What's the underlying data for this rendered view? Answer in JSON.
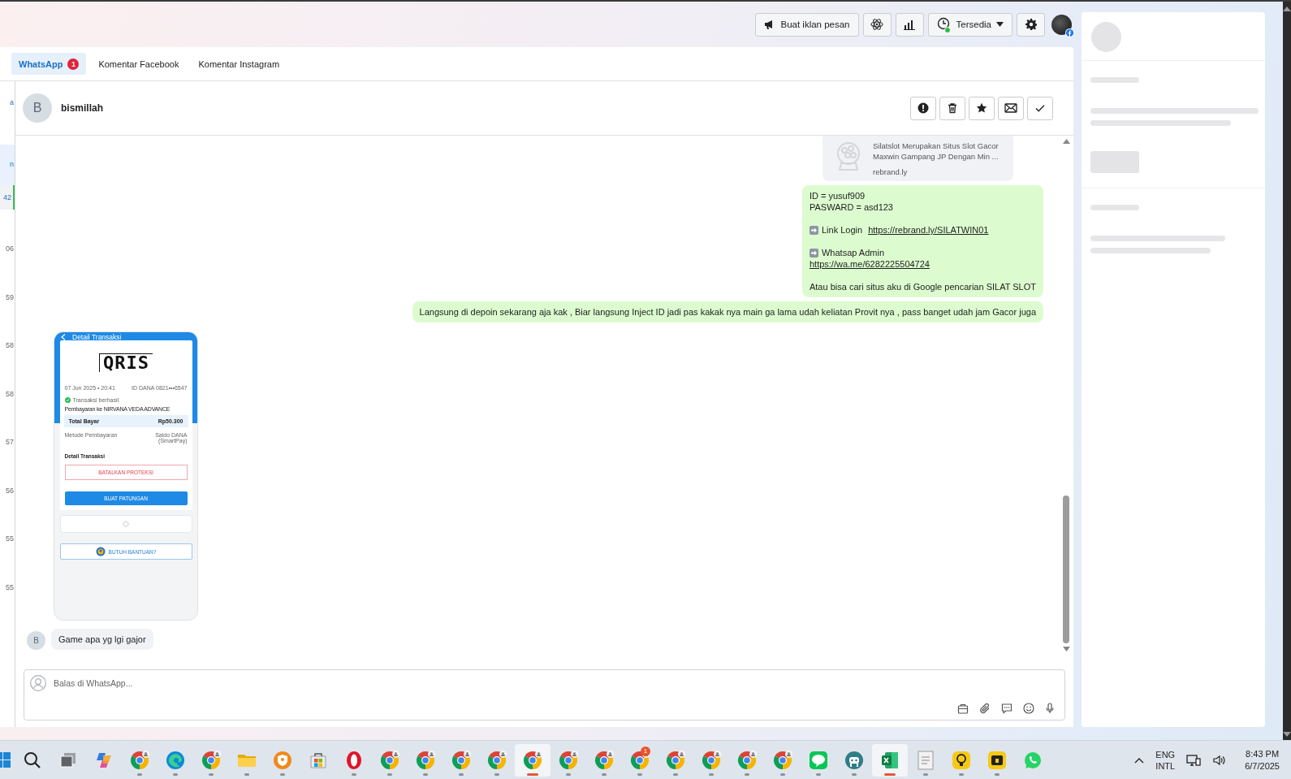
{
  "topbar": {
    "buttons": [
      {
        "kind": "ad",
        "label": "Buat iklan pesan"
      },
      {
        "kind": "atom"
      },
      {
        "kind": "chart"
      },
      {
        "kind": "status",
        "label": "Tersedia",
        "online": true
      },
      {
        "kind": "settings"
      }
    ]
  },
  "tabs": [
    {
      "label": "WhatsApp",
      "badge": "1",
      "selected": true
    },
    {
      "label": "Komentar Facebook",
      "selected": false
    },
    {
      "label": "Komentar Instagram",
      "selected": false
    }
  ],
  "conversation_list": {
    "items": [
      {
        "kind": "link",
        "text": "a",
        "selected": false
      },
      {
        "kind": "highlight",
        "text": "n",
        "selected": false
      },
      {
        "kind": "time",
        "text": "42",
        "selected": true
      },
      {
        "kind": "time",
        "text": "06",
        "selected": false
      },
      {
        "kind": "time",
        "text": "59",
        "selected": false
      },
      {
        "kind": "time",
        "text": "58",
        "selected": false
      },
      {
        "kind": "time",
        "text": "58",
        "selected": false
      },
      {
        "kind": "time",
        "text": "57",
        "selected": false
      },
      {
        "kind": "time",
        "text": "56",
        "selected": false
      },
      {
        "kind": "time",
        "text": "55",
        "selected": false
      },
      {
        "kind": "time",
        "text": "55",
        "selected": false
      }
    ]
  },
  "chat": {
    "contact": {
      "initial": "B",
      "name": "bismillah"
    },
    "actions": [
      {
        "kind": "report"
      },
      {
        "kind": "delete"
      },
      {
        "kind": "star"
      },
      {
        "kind": "unread"
      },
      {
        "kind": "done"
      }
    ],
    "messages": [
      {
        "kind": "link-preview",
        "outgoing": true,
        "description_lines": [
          "Silatslot Merupakan Situs Slot Gacor",
          "Maxwin Gampang JP Dengan Min ..."
        ],
        "domain": "rebrand.ly"
      },
      {
        "kind": "text",
        "outgoing": true,
        "blocks": [
          {
            "kind": "lines",
            "lines": [
              "ID = yusuf909",
              "PASWARD = asd123"
            ]
          },
          {
            "kind": "arrow-link",
            "label": "Link Login",
            "link": "https://rebrand.ly/SILATWIN01",
            "link_below": false
          },
          {
            "kind": "arrow-link",
            "label": "Whatsap Admin",
            "link": "https://wa.me/6282225504724",
            "link_below": true
          },
          {
            "kind": "lines",
            "lines": [
              "Atau bisa cari situs aku di Google pencarian SILAT SLOT"
            ]
          }
        ]
      },
      {
        "kind": "text",
        "outgoing": true,
        "blocks": [
          {
            "kind": "lines",
            "lines": [
              "Langsung di depoin sekarang aja kak , Biar langsung Inject ID jadi pas kakak nya main ga lama udah keliatan Provit nya , pass banget udah jam Gacor juga"
            ]
          }
        ]
      },
      {
        "kind": "image",
        "outgoing": false,
        "screenshot": {
          "title": "Detail Transaksi",
          "logo": "QRIS",
          "date": "07 Jun 2025 • 20:41",
          "account": "ID DANA 0821•••6547",
          "status": "Transaksi berhasil",
          "payee": "Pembayaran ke NIRVANA VEDA ADVANCE",
          "total_label": "Total Bayar",
          "total": "Rp50.300",
          "method_label": "Metode Pembayaran",
          "method_lines": [
            "Saldo DANA",
            "(SmartPay)"
          ],
          "details_label": "Detail Transaksi",
          "cancel_button": "BATALKAN PROTEKSI",
          "split_button": "BUAT PATUNGAN",
          "help_button": "BUTUH BANTUAN?"
        }
      },
      {
        "kind": "text",
        "outgoing": false,
        "sender_initial": "B",
        "blocks": [
          {
            "kind": "lines",
            "lines": [
              "Game apa yg lgi gajor"
            ]
          }
        ]
      }
    ]
  },
  "composer": {
    "placeholder": "Balas di WhatsApp..."
  },
  "taskbar": {
    "apps": [
      {
        "kind": "start",
        "running": false,
        "active": false
      },
      {
        "kind": "search",
        "running": false,
        "active": false
      },
      {
        "kind": "taskview",
        "running": false,
        "active": false
      },
      {
        "kind": "copilot",
        "running": false,
        "active": false
      },
      {
        "kind": "chrome",
        "running": true,
        "active": false
      },
      {
        "kind": "edge",
        "running": true,
        "active": false
      },
      {
        "kind": "chrome",
        "running": true,
        "active": false
      },
      {
        "kind": "files",
        "running": true,
        "active": false
      },
      {
        "kind": "vpn",
        "running": true,
        "active": false
      },
      {
        "kind": "store",
        "running": false,
        "active": false
      },
      {
        "kind": "opera",
        "running": true,
        "active": false
      },
      {
        "kind": "chrome",
        "running": true,
        "active": false
      },
      {
        "kind": "chrome",
        "running": true,
        "active": false
      },
      {
        "kind": "chrome",
        "running": true,
        "active": false
      },
      {
        "kind": "chrome",
        "running": true,
        "active": false
      },
      {
        "kind": "chrome",
        "running": true,
        "active": true
      },
      {
        "kind": "chrome",
        "running": true,
        "active": false
      },
      {
        "kind": "chrome",
        "running": true,
        "active": false
      },
      {
        "kind": "chrome",
        "running": true,
        "active": false,
        "badge": "1"
      },
      {
        "kind": "chrome",
        "running": true,
        "active": false
      },
      {
        "kind": "chrome",
        "running": true,
        "active": false
      },
      {
        "kind": "chrome",
        "running": true,
        "active": false
      },
      {
        "kind": "chrome",
        "running": true,
        "active": false
      },
      {
        "kind": "line",
        "running": true,
        "active": false
      },
      {
        "kind": "github",
        "running": true,
        "active": false
      },
      {
        "kind": "excel",
        "running": true,
        "active": true
      },
      {
        "kind": "document",
        "running": true,
        "active": false
      },
      {
        "kind": "bulb",
        "running": true,
        "active": false
      },
      {
        "kind": "yellow-app",
        "running": true,
        "active": false
      },
      {
        "kind": "whatsapp",
        "running": false,
        "active": false
      }
    ],
    "tray": {
      "language": "ENG",
      "layout": "INTL",
      "time": "8:43 PM",
      "date": "6/7/2025"
    }
  }
}
